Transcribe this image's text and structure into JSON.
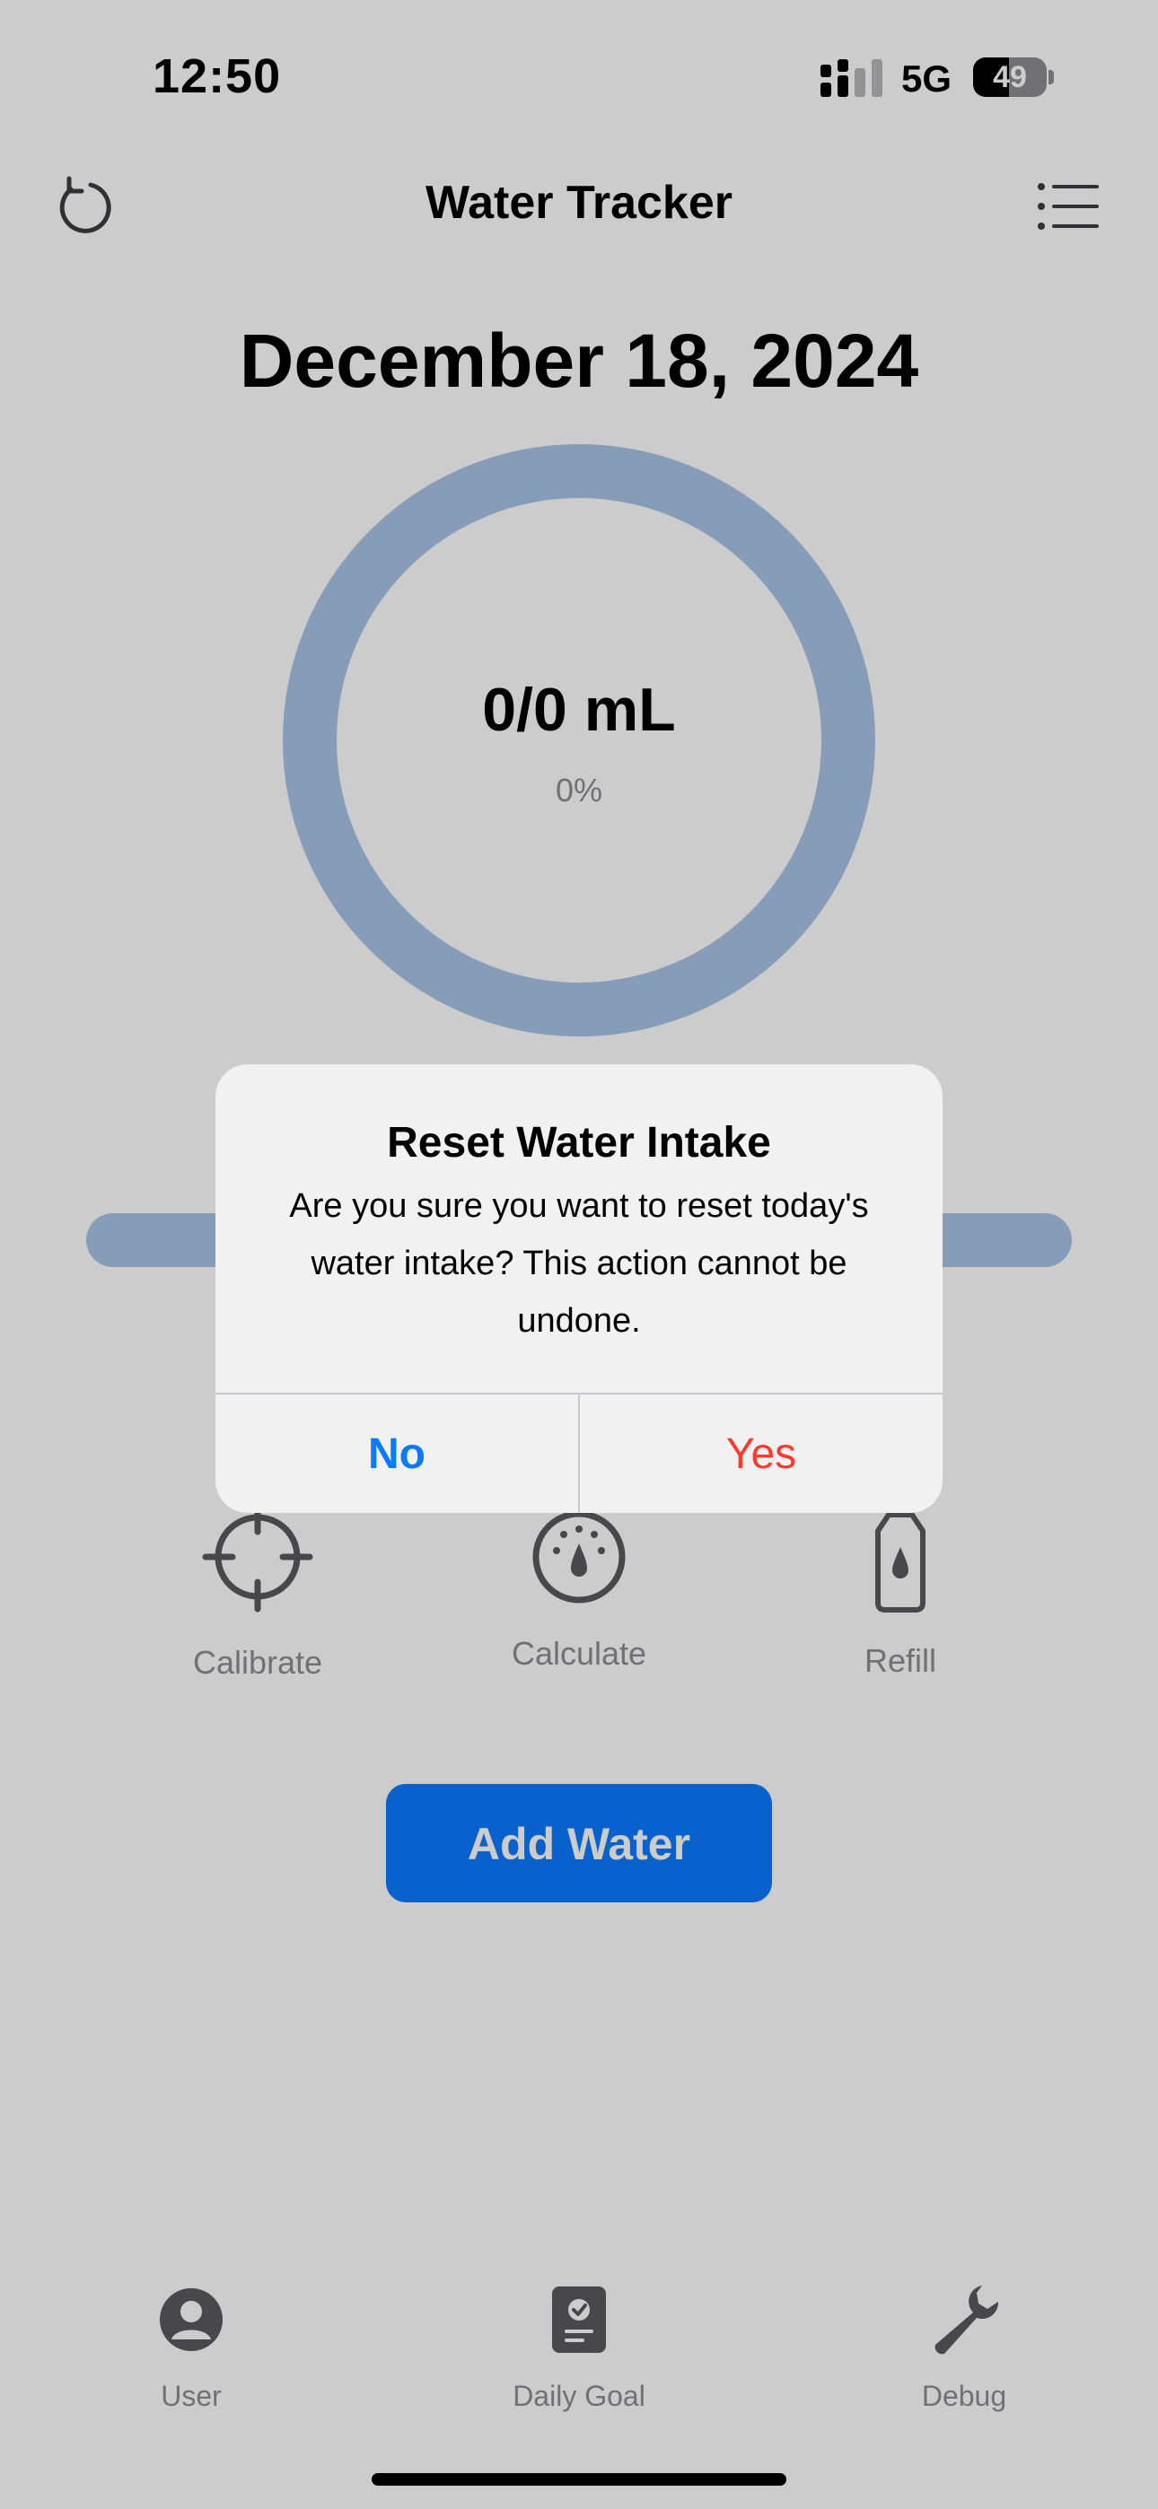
{
  "status_bar": {
    "time": "12:50",
    "network": "5G",
    "battery": "49",
    "battery_level": 0.49
  },
  "nav": {
    "title": "Water Tracker",
    "left_icon": "reset-icon",
    "right_icon": "list-icon"
  },
  "date": "December 18, 2024",
  "progress": {
    "amount": "0/0 mL",
    "percent": "0%",
    "fraction": 0
  },
  "actions": [
    {
      "label": "Calibrate",
      "icon": "crosshair-icon"
    },
    {
      "label": "Calculate",
      "icon": "gauge-icon"
    },
    {
      "label": "Refill",
      "icon": "bottle-icon"
    }
  ],
  "add_water_label": "Add Water",
  "tabs": [
    {
      "label": "User",
      "icon": "person-icon"
    },
    {
      "label": "Daily Goal",
      "icon": "goal-icon"
    },
    {
      "label": "Debug",
      "icon": "wrench-icon"
    }
  ],
  "alert": {
    "title": "Reset Water Intake",
    "message": "Are you sure you want to reset today's water intake? This action cannot be undone.",
    "no_label": "No",
    "yes_label": "Yes"
  },
  "colors": {
    "accent": "#0a7aff",
    "destructive": "#ff3b30",
    "ring": "#a8c4e8",
    "muted": "#8e8e93"
  }
}
